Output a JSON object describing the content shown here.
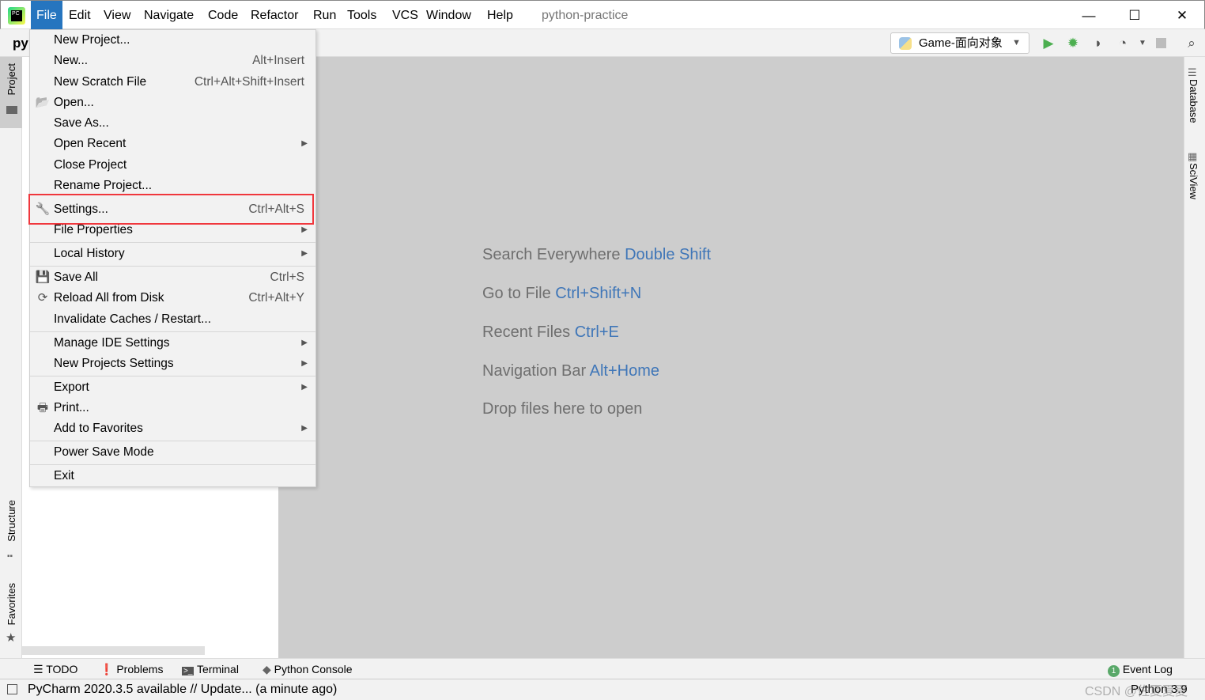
{
  "menubar": {
    "items": [
      "File",
      "Edit",
      "View",
      "Navigate",
      "Code",
      "Refactor",
      "Run",
      "Tools",
      "VCS",
      "Window",
      "Help"
    ],
    "project_title": "python-practice",
    "active": "File"
  },
  "window_controls": {
    "minimize": "—",
    "maximize": "☐",
    "close": "✕"
  },
  "toolbar": {
    "breadcrumb": "py",
    "run_config": "Game-面向对象",
    "icons": [
      "run-icon",
      "debug-icon",
      "coverage-icon",
      "profile-icon",
      "stop-icon",
      "search-icon"
    ]
  },
  "left_stripe": {
    "project": "Project",
    "structure": "Structure",
    "favorites": "Favorites"
  },
  "right_stripe": {
    "database": "Database",
    "sciview": "SciView"
  },
  "file_menu": {
    "items": [
      {
        "label": "New Project...",
        "shortcut": ""
      },
      {
        "label": "New...",
        "shortcut": "Alt+Insert"
      },
      {
        "label": "New Scratch File",
        "shortcut": "Ctrl+Alt+Shift+Insert"
      },
      {
        "label": "Open...",
        "shortcut": "",
        "icon": "folder-icon"
      },
      {
        "label": "Save As...",
        "shortcut": ""
      },
      {
        "label": "Open Recent",
        "submenu": true
      },
      {
        "label": "Close Project",
        "shortcut": ""
      },
      {
        "label": "Rename Project...",
        "shortcut": ""
      },
      {
        "label": "Settings...",
        "shortcut": "Ctrl+Alt+S",
        "icon": "wrench-icon",
        "highlighted": true
      },
      {
        "label": "File Properties",
        "submenu": true
      },
      {
        "label": "Local History",
        "submenu": true
      },
      {
        "label": "Save All",
        "shortcut": "Ctrl+S",
        "icon": "save-icon"
      },
      {
        "label": "Reload All from Disk",
        "shortcut": "Ctrl+Alt+Y",
        "icon": "reload-icon"
      },
      {
        "label": "Invalidate Caches / Restart...",
        "shortcut": ""
      },
      {
        "label": "Manage IDE Settings",
        "submenu": true
      },
      {
        "label": "New Projects Settings",
        "submenu": true
      },
      {
        "label": "Export",
        "submenu": true
      },
      {
        "label": "Print...",
        "shortcut": "",
        "icon": "printer-icon"
      },
      {
        "label": "Add to Favorites",
        "submenu": true
      },
      {
        "label": "Power Save Mode",
        "shortcut": ""
      },
      {
        "label": "Exit",
        "shortcut": ""
      }
    ]
  },
  "editor_hints": [
    {
      "text": "Search Everywhere",
      "key": "Double Shift"
    },
    {
      "text": "Go to File",
      "key": "Ctrl+Shift+N"
    },
    {
      "text": "Recent Files",
      "key": "Ctrl+E"
    },
    {
      "text": "Navigation Bar",
      "key": "Alt+Home"
    },
    {
      "text": "Drop files here to open",
      "key": ""
    }
  ],
  "bottom_tabs": [
    "TODO",
    "Problems",
    "Terminal",
    "Python Console"
  ],
  "event_log": {
    "label": "Event Log",
    "count": "1"
  },
  "status": {
    "message": "PyCharm 2020.3.5 available // Update... (a minute ago)",
    "interpreter": "Python 3.9",
    "watermark": "CSDN @佐夏夏夏"
  },
  "colors": {
    "accent": "#2675bf",
    "highlight_box": "#f0373d",
    "hint_key": "#3f76b8",
    "run_green": "#4caf50"
  }
}
